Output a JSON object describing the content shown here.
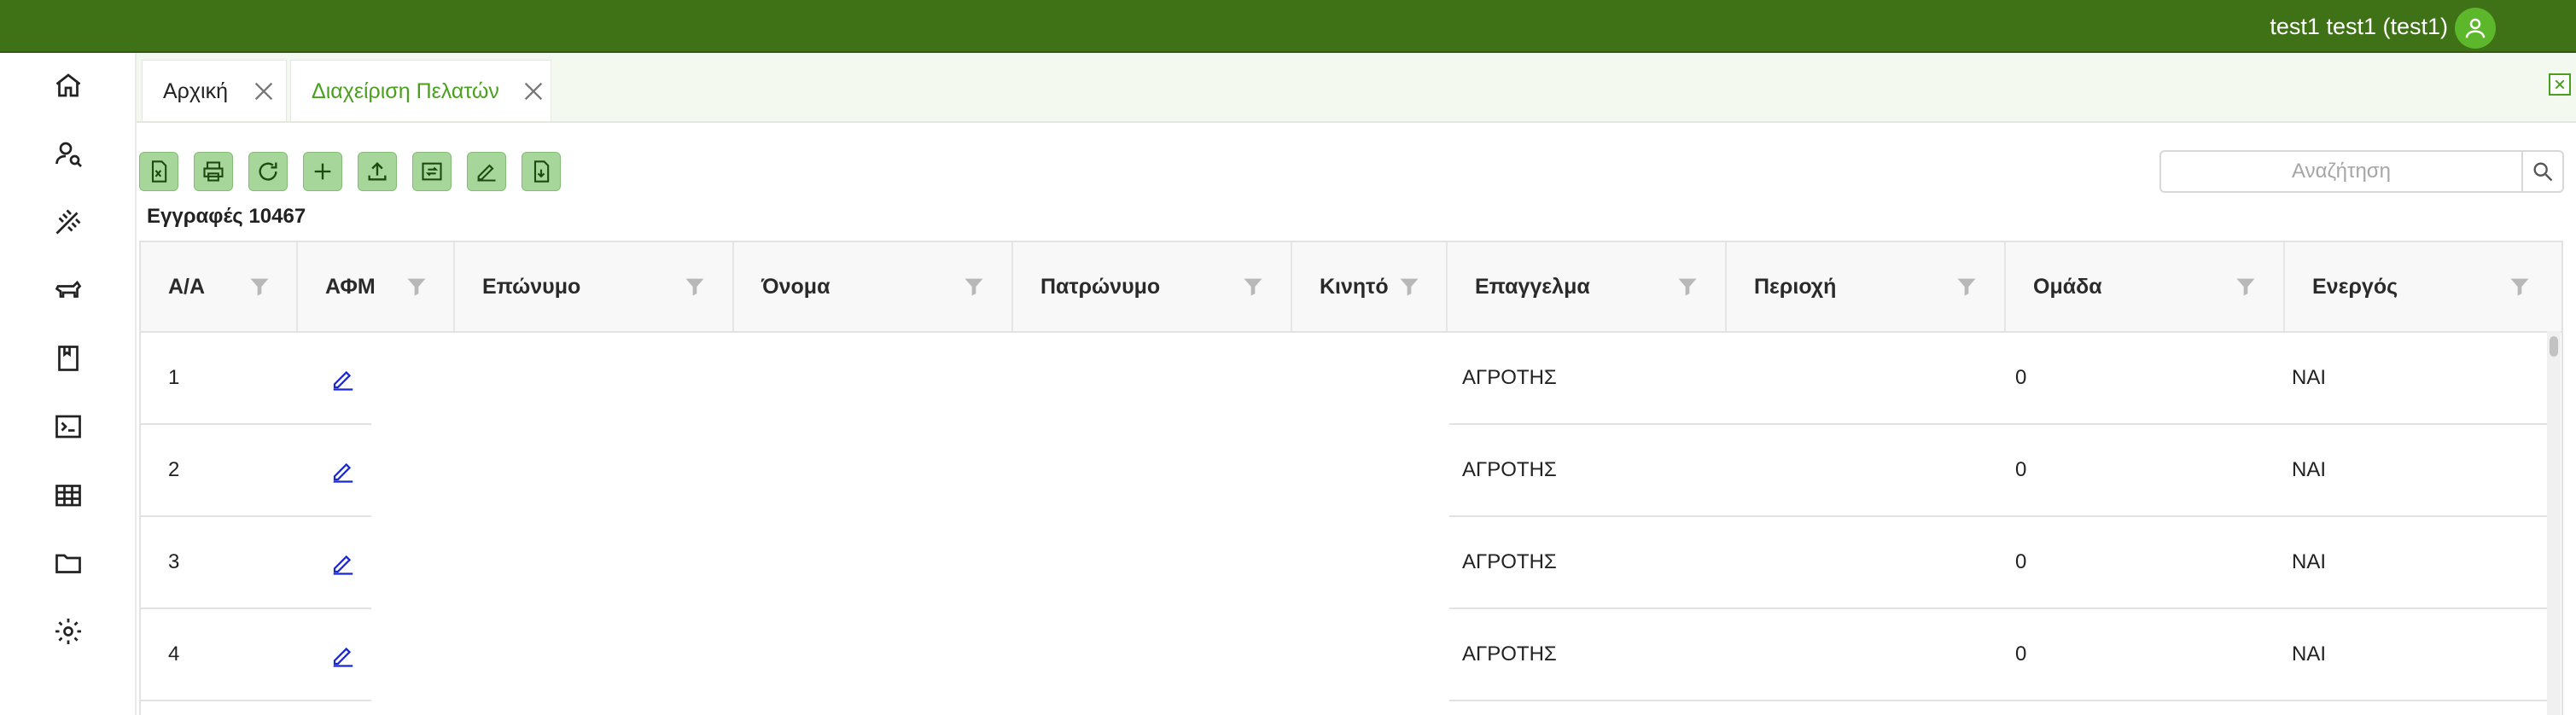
{
  "topbar": {
    "user_label": "test1 test1 (test1)",
    "avatar_icon": "user-avatar-icon"
  },
  "sidebar": {
    "items": [
      {
        "icon": "home-icon"
      },
      {
        "icon": "user-search-icon"
      },
      {
        "icon": "wheat-icon"
      },
      {
        "icon": "livestock-icon"
      },
      {
        "icon": "book-icon"
      },
      {
        "icon": "terminal-icon"
      },
      {
        "icon": "table-icon"
      },
      {
        "icon": "folder-icon"
      },
      {
        "icon": "gear-icon"
      }
    ]
  },
  "tabs": [
    {
      "label": "Αρχική",
      "active": false
    },
    {
      "label": "Διαχείριση Πελατών",
      "active": true
    }
  ],
  "toolbar": {
    "buttons": [
      "export-excel-icon",
      "print-icon",
      "refresh-icon",
      "add-icon",
      "upload-icon",
      "sync-icon",
      "edit-pen-icon",
      "import-file-icon"
    ]
  },
  "records_label": "Εγγραφές 10467",
  "search": {
    "placeholder": "Αναζήτηση"
  },
  "table": {
    "columns": [
      "Α/Α",
      "ΑΦΜ",
      "Επώνυμο",
      "Όνομα",
      "Πατρώνυμο",
      "Κινητό",
      "Επαγγελμα",
      "Περιοχή",
      "Ομάδα",
      "Ενεργός"
    ],
    "rows": [
      {
        "aa": "1",
        "afm": "",
        "eponymo": "",
        "onoma": "",
        "patronymo": "",
        "kinito": "",
        "epaggelma": "ΑΓΡΟΤΗΣ",
        "perioxi": "",
        "omada": "0",
        "energos": "ΝΑΙ"
      },
      {
        "aa": "2",
        "afm": "",
        "eponymo": "",
        "onoma": "",
        "patronymo": "",
        "kinito": "",
        "epaggelma": "ΑΓΡΟΤΗΣ",
        "perioxi": "",
        "omada": "0",
        "energos": "ΝΑΙ"
      },
      {
        "aa": "3",
        "afm": "",
        "eponymo": "",
        "onoma": "",
        "patronymo": "",
        "kinito": "",
        "epaggelma": "ΑΓΡΟΤΗΣ",
        "perioxi": "",
        "omada": "0",
        "energos": "ΝΑΙ"
      },
      {
        "aa": "4",
        "afm": "",
        "eponymo": "",
        "onoma": "",
        "patronymo": "",
        "kinito": "",
        "epaggelma": "ΑΓΡΟΤΗΣ",
        "perioxi": "",
        "omada": "0",
        "energos": "ΝΑΙ"
      }
    ]
  },
  "colors": {
    "topbar": "#3f7216",
    "accent": "#4aa01e",
    "tool_button": "#a6d69a",
    "edit_link": "#1a27c9"
  }
}
